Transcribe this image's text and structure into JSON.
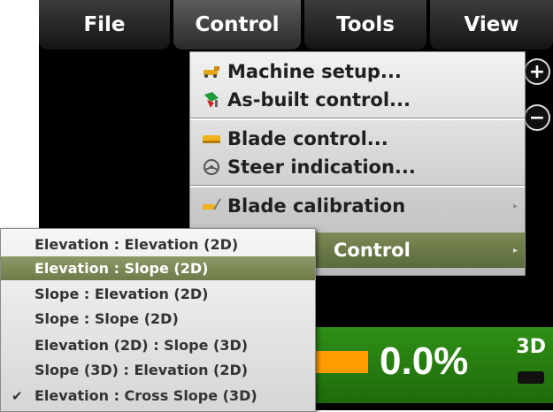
{
  "menubar": {
    "items": [
      {
        "label": "File"
      },
      {
        "label": "Control"
      },
      {
        "label": "Tools"
      },
      {
        "label": "View"
      }
    ]
  },
  "zoom": {
    "in_label": "+",
    "out_label": "−"
  },
  "control_menu": {
    "items": [
      {
        "label": "Machine setup...",
        "icon": "machine-setup-icon"
      },
      {
        "label": "As-built control...",
        "icon": "as-built-icon"
      },
      {
        "label": "Blade control...",
        "icon": "blade-icon"
      },
      {
        "label": "Steer indication...",
        "icon": "steer-icon"
      },
      {
        "label": "Blade calibration",
        "icon": "blade-calibration-icon"
      },
      {
        "label": "Control",
        "icon": "control-icon"
      }
    ]
  },
  "submenu": {
    "items": [
      {
        "label": "Elevation : Elevation (2D)",
        "checked": false
      },
      {
        "label": "Elevation : Slope (2D)",
        "checked": false
      },
      {
        "label": "Slope : Elevation (2D)",
        "checked": false
      },
      {
        "label": "Slope : Slope (2D)",
        "checked": false
      },
      {
        "label": "Elevation (2D) : Slope (3D)",
        "checked": false
      },
      {
        "label": "Slope (3D) : Elevation (2D)",
        "checked": false
      },
      {
        "label": "Elevation : Cross Slope (3D)",
        "checked": true
      }
    ],
    "check_glyph": "✔"
  },
  "status": {
    "percent": "0.0%",
    "mode": "3D",
    "colors": {
      "bar": "#ff9d00",
      "panel": "#2f8f16",
      "highlight": "#6e7b4a"
    }
  }
}
